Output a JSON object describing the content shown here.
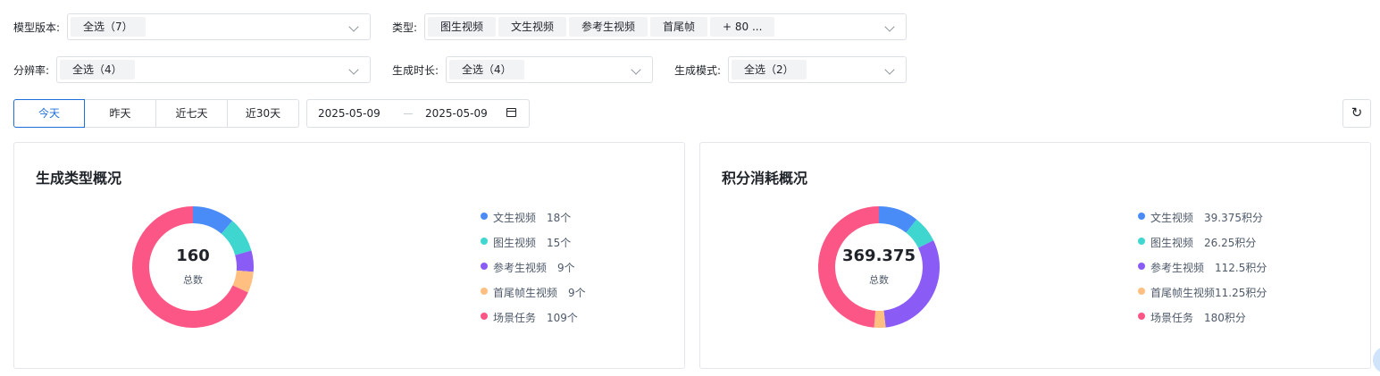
{
  "filters": {
    "model_version": {
      "label": "模型版本:",
      "tags": [
        "全选（7）"
      ]
    },
    "type": {
      "label": "类型:",
      "tags": [
        "图生视频",
        "文生视频",
        "参考生视频",
        "首尾帧",
        "+ 80 ..."
      ]
    },
    "resolution": {
      "label": "分辨率:",
      "tags": [
        "全选（4）"
      ]
    },
    "duration": {
      "label": "生成时长:",
      "tags": [
        "全选（4）"
      ]
    },
    "mode": {
      "label": "生成模式:",
      "tags": [
        "全选（2）"
      ]
    }
  },
  "range_tabs": [
    "今天",
    "昨天",
    "近七天",
    "近30天"
  ],
  "active_tab": "今天",
  "date_range": {
    "start": "2025-05-09",
    "end": "2025-05-09"
  },
  "colors": {
    "blue": "#4a8cf7",
    "teal": "#3ed6cf",
    "purple": "#8a5cf5",
    "orange": "#ffbf80",
    "pink": "#fb5685"
  },
  "cards": [
    {
      "title": "生成类型概况",
      "total": "160",
      "total_label": "总数",
      "items": [
        {
          "name": "文生视频",
          "value_text": "18个",
          "value": 18,
          "color": "#4a8cf7"
        },
        {
          "name": "图生视频",
          "value_text": "15个",
          "value": 15,
          "color": "#3ed6cf"
        },
        {
          "name": "参考生视频",
          "value_text": "9个",
          "value": 9,
          "color": "#8a5cf5"
        },
        {
          "name": "首尾帧生视频",
          "value_text": "9个",
          "value": 9,
          "color": "#ffbf80"
        },
        {
          "name": "场景任务",
          "value_text": "109个",
          "value": 109,
          "color": "#fb5685"
        }
      ]
    },
    {
      "title": "积分消耗概况",
      "total": "369.375",
      "total_label": "总数",
      "items": [
        {
          "name": "文生视频",
          "value_text": "39.375积分",
          "value": 39.375,
          "color": "#4a8cf7"
        },
        {
          "name": "图生视频",
          "value_text": "26.25积分",
          "value": 26.25,
          "color": "#3ed6cf"
        },
        {
          "name": "参考生视频",
          "value_text": "112.5积分",
          "value": 112.5,
          "color": "#8a5cf5"
        },
        {
          "name": "首尾帧生视频",
          "value_text": "11.25积分",
          "value": 11.25,
          "color": "#ffbf80"
        },
        {
          "name": "场景任务",
          "value_text": "180积分",
          "value": 180,
          "color": "#fb5685"
        }
      ]
    }
  ]
}
